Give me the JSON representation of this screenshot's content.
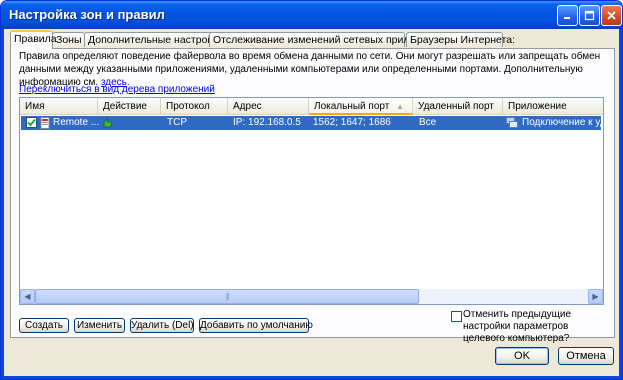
{
  "window": {
    "title": "Настройка зон и правил",
    "controls": [
      "minimize-icon",
      "maximize-icon",
      "close-icon"
    ],
    "title_bar_color": "#0453df"
  },
  "tabs": [
    {
      "label": "Правила",
      "active": true
    },
    {
      "label": "Зоны"
    },
    {
      "label": "Дополнительные настройки"
    },
    {
      "label": "Отслеживание изменений сетевых приложений"
    },
    {
      "label": "Браузеры Интернета:"
    }
  ],
  "description": {
    "text": "Правила определяют поведение файервола во время обмена данными по сети. Они могут разрешать или запрещать обмен данными между указанными приложениями, удаленными компьютерами или определенными портами. Дополнительную информацию см.",
    "link": "здесь",
    "suffix": "."
  },
  "switch_link": "Переключиться в вид дерева приложений",
  "table": {
    "columns": [
      "Имя",
      "Действие",
      "Протокол",
      "Адрес",
      "Локальный порт",
      "Удаленный порт",
      "Приложение"
    ],
    "sorted_column": "Локальный порт",
    "rows": [
      {
        "checked": true,
        "name": "Remote ...",
        "action_icon": "allow-icon",
        "protocol": "TCP",
        "address": "IP: 192.168.0.5",
        "local_port": "1562; 1647; 1686",
        "remote_port": "Все",
        "application": "Подключение к уда",
        "app_icon": "remote-desktop-icon"
      }
    ]
  },
  "buttons": {
    "create": "Создать",
    "edit": "Изменить",
    "delete": "Удалить (Del)",
    "add_default": "Добавить по умолчанию",
    "ok": "OK",
    "cancel": "Отмена"
  },
  "option": {
    "checked": false,
    "text": "Отменить предыдущие настройки параметров целевого компьютера?"
  },
  "colors": {
    "selection": "#316ac5",
    "link": "#0000ee",
    "active_tab_accent": "#ffc83c"
  }
}
